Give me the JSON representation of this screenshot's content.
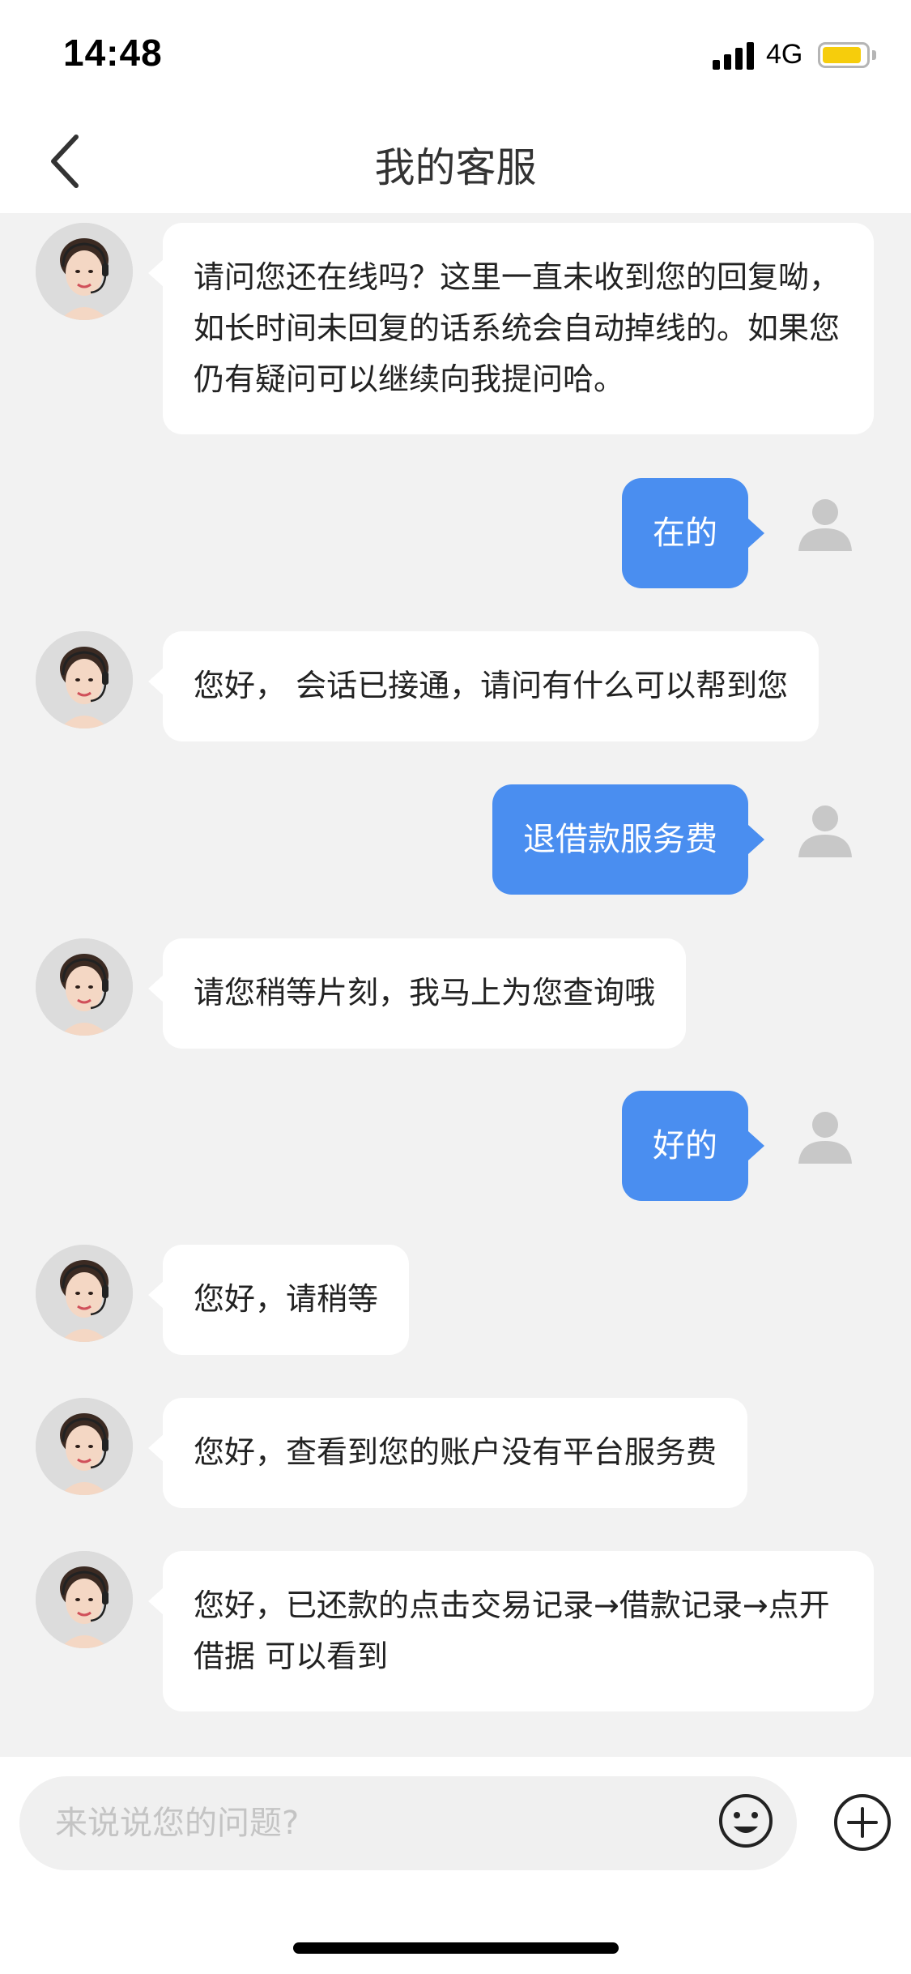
{
  "status_bar": {
    "time": "14:48",
    "network": "4G",
    "signal_bars": 4,
    "battery_level": 0.9,
    "battery_color": "#f6cd0c"
  },
  "nav": {
    "title": "我的客服",
    "back_icon": "chevron-left-icon"
  },
  "messages": [
    {
      "sender": "agent",
      "text": "请问您还在线吗？这里一直未收到您的回复呦，如长时间未回复的话系统会自动掉线的。如果您仍有疑问可以继续向我提问哈。"
    },
    {
      "sender": "user",
      "text": "在的"
    },
    {
      "sender": "agent",
      "text": "您好， 会话已接通，请问有什么可以帮到您"
    },
    {
      "sender": "user",
      "text": "退借款服务费"
    },
    {
      "sender": "agent",
      "text": "请您稍等片刻，我马上为您查询哦"
    },
    {
      "sender": "user",
      "text": "好的"
    },
    {
      "sender": "agent",
      "text": "您好，请稍等"
    },
    {
      "sender": "agent",
      "text": "您好，查看到您的账户没有平台服务费"
    },
    {
      "sender": "agent",
      "text": "您好，已还款的点击交易记录→借款记录→点开借据 可以看到"
    }
  ],
  "input": {
    "placeholder": "来说说您的问题?",
    "value": "",
    "emoji_icon": "smiley-icon",
    "plus_icon": "plus-circle-icon"
  },
  "colors": {
    "user_bubble": "#4a8ef0",
    "agent_bubble": "#ffffff",
    "chat_background": "#f2f2f2"
  }
}
